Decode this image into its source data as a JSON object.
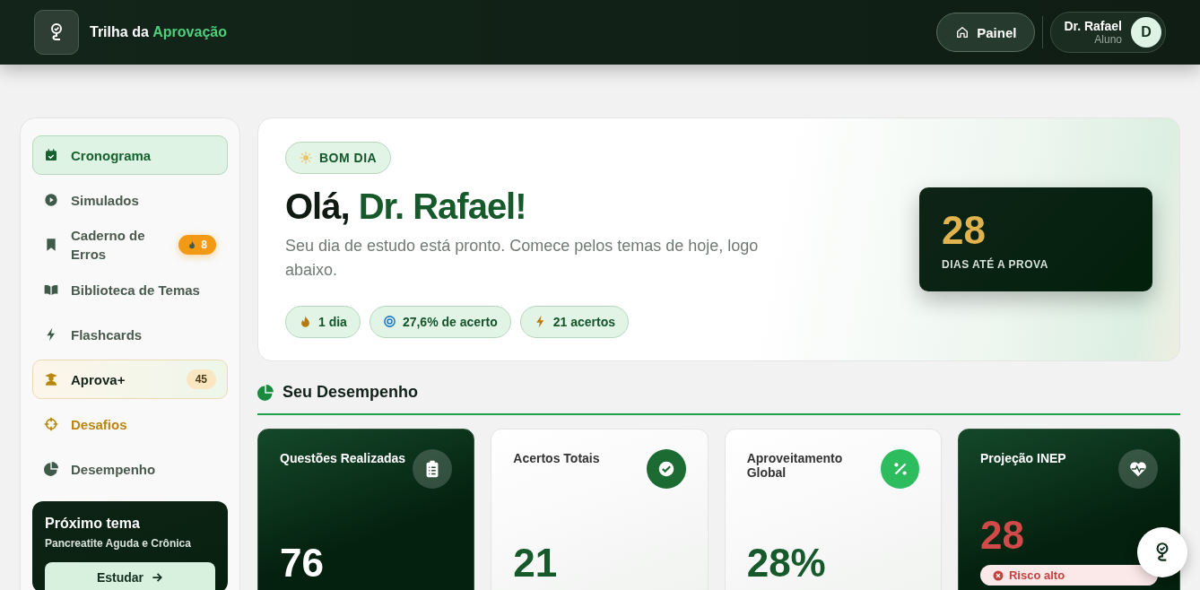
{
  "header": {
    "brand": "Trilha da **Aprovação**",
    "nav_button": "Painel",
    "user": {
      "name": "Dr. Rafael",
      "role": "Aluno",
      "initial": "D"
    }
  },
  "sidebar": {
    "items": [
      {
        "label": "Cronograma",
        "selected": true,
        "kind": "normal"
      },
      {
        "label": "Simulados",
        "selected": false,
        "kind": "normal"
      },
      {
        "label": "Caderno de Erros",
        "selected": false,
        "kind": "normal",
        "badge": "8"
      },
      {
        "label": "Biblioteca de Temas",
        "selected": false,
        "kind": "normal"
      },
      {
        "label": "Flashcards",
        "selected": false,
        "kind": "normal"
      },
      {
        "label": "Aprova+",
        "selected": false,
        "kind": "premium",
        "badge": "45"
      },
      {
        "label": "Desafios",
        "selected": false,
        "kind": "highlight"
      },
      {
        "label": "Desempenho",
        "selected": false,
        "kind": "normal"
      }
    ],
    "next_topic": {
      "title": "Próximo tema",
      "topic": "Pancreatite Aguda e Crônica",
      "button": "Estudar"
    }
  },
  "hero": {
    "greeting_badge": "BOM DIA",
    "title_prefix": "Olá,",
    "title_name": "Dr. Rafael!",
    "subtitle": "Seu dia de estudo está pronto. Comece pelos temas de hoje, logo abaixo.",
    "chips": [
      "1 dia",
      "27,6% de acerto",
      "21 acertos"
    ],
    "countdown": {
      "value": "28",
      "label": "DIAS ATÉ A PROVA"
    }
  },
  "performance": {
    "title": "Seu Desempenho",
    "cards": [
      {
        "label": "Questões Realizadas",
        "value": "76",
        "kind": "dark"
      },
      {
        "label": "Acertos Totais",
        "value": "21",
        "kind": "light"
      },
      {
        "label": "Aproveitamento Global",
        "value": "28%",
        "kind": "light"
      },
      {
        "label": "Projeção INEP",
        "value": "28",
        "kind": "dark",
        "risk": "Risco alto"
      }
    ]
  }
}
